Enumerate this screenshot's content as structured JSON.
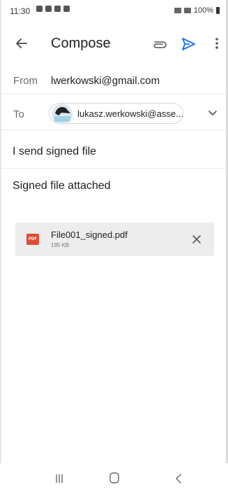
{
  "status_bar": {
    "time": "11:30",
    "battery": "100%"
  },
  "app_bar": {
    "title": "Compose"
  },
  "from": {
    "label": "From",
    "value": "lwerkowski@gmail.com"
  },
  "to": {
    "label": "To",
    "recipient": "lukasz.werkowski@asse..."
  },
  "subject": "I send signed file",
  "body": "Signed file attached",
  "attachment": {
    "icon_label": "PDF",
    "name": "File001_signed.pdf",
    "size": "195 KB"
  },
  "colors": {
    "send_icon": "#1a73e8",
    "pdf_icon": "#e14b36",
    "attachment_bg": "#ededed"
  }
}
